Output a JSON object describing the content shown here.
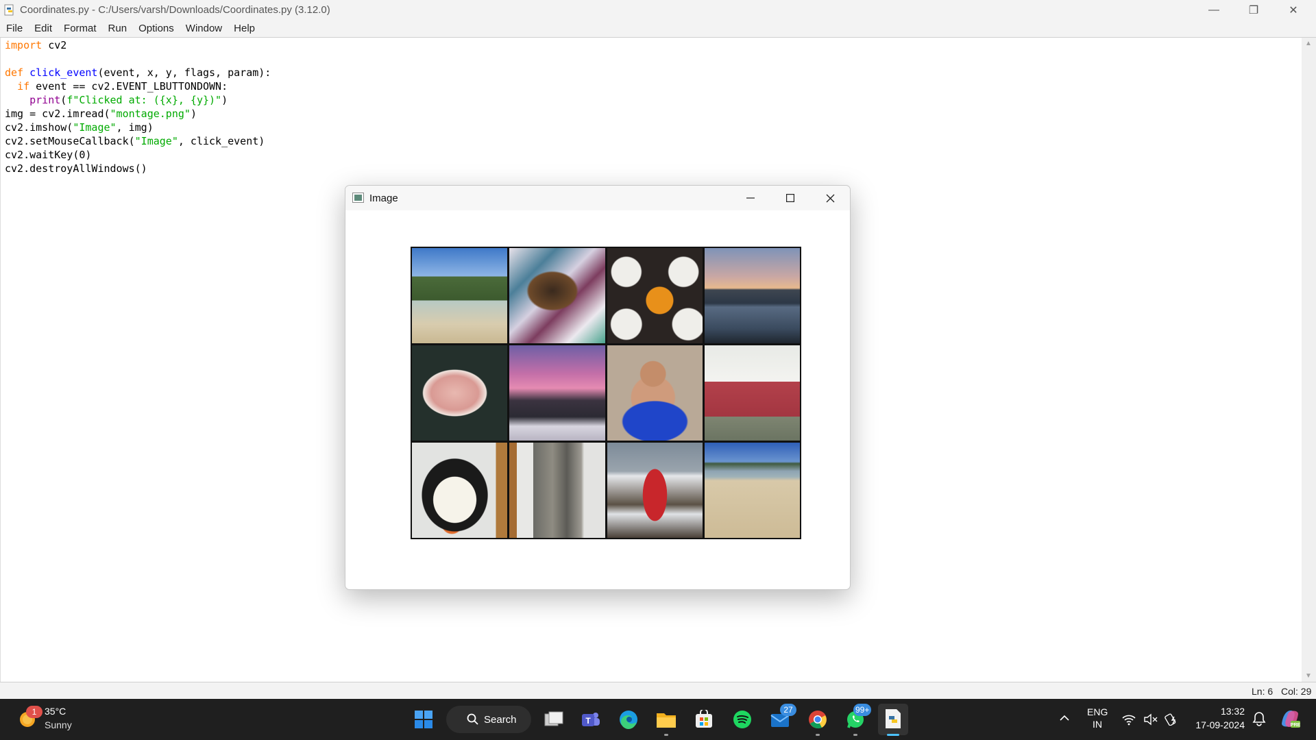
{
  "window": {
    "title": "Coordinates.py - C:/Users/varsh/Downloads/Coordinates.py (3.12.0)",
    "minimize_glyph": "—",
    "restore_glyph": "❐",
    "close_glyph": "✕"
  },
  "menu": [
    "File",
    "Edit",
    "Format",
    "Run",
    "Options",
    "Window",
    "Help"
  ],
  "code": {
    "line1_kw": "import",
    "line1_rest": " cv2",
    "line3_kw": "def",
    "line3_fn": "click_event",
    "line3_rest": "(event, x, y, flags, param):",
    "line4_indent": "  ",
    "line4_kw": "if",
    "line4_rest": " event == cv2.EVENT_LBUTTONDOWN:",
    "line5_indent": "    ",
    "line5_bi": "print",
    "line5_p1": "(",
    "line5_str": "f\"Clicked at: ({x}, {y})\"",
    "line5_p2": ")",
    "line6_a": "img = cv2.imread(",
    "line6_str": "\"montage.png\"",
    "line6_b": ")",
    "line7_a": "cv2.imshow(",
    "line7_str": "\"Image\"",
    "line7_b": ", img)",
    "line8_a": "cv2.setMouseCallback(",
    "line8_str": "\"Image\"",
    "line8_b": ", click_event)",
    "line9": "cv2.waitKey(0)",
    "line10": "cv2.destroyAllWindows()"
  },
  "status": {
    "line": "Ln: 6",
    "col": "Col: 29"
  },
  "image_window": {
    "title": "Image",
    "tiles": [
      "beach-cove",
      "calico-cat",
      "cupcakes",
      "lake-sunset",
      "fish-fillet",
      "pink-winter-sky",
      "toddler-in-bucket",
      "red-sofa",
      "penguin-plush",
      "shirts-on-hanger",
      "fire-hydrant-snow",
      "sandy-beach"
    ]
  },
  "taskbar": {
    "weather_temp": "35°C",
    "weather_desc": "Sunny",
    "weather_badge": "1",
    "search_label": "Search",
    "mail_badge": "27",
    "whatsapp_badge": "99+",
    "lang_top": "ENG",
    "lang_bottom": "IN",
    "time": "13:32",
    "date": "17-09-2024"
  }
}
